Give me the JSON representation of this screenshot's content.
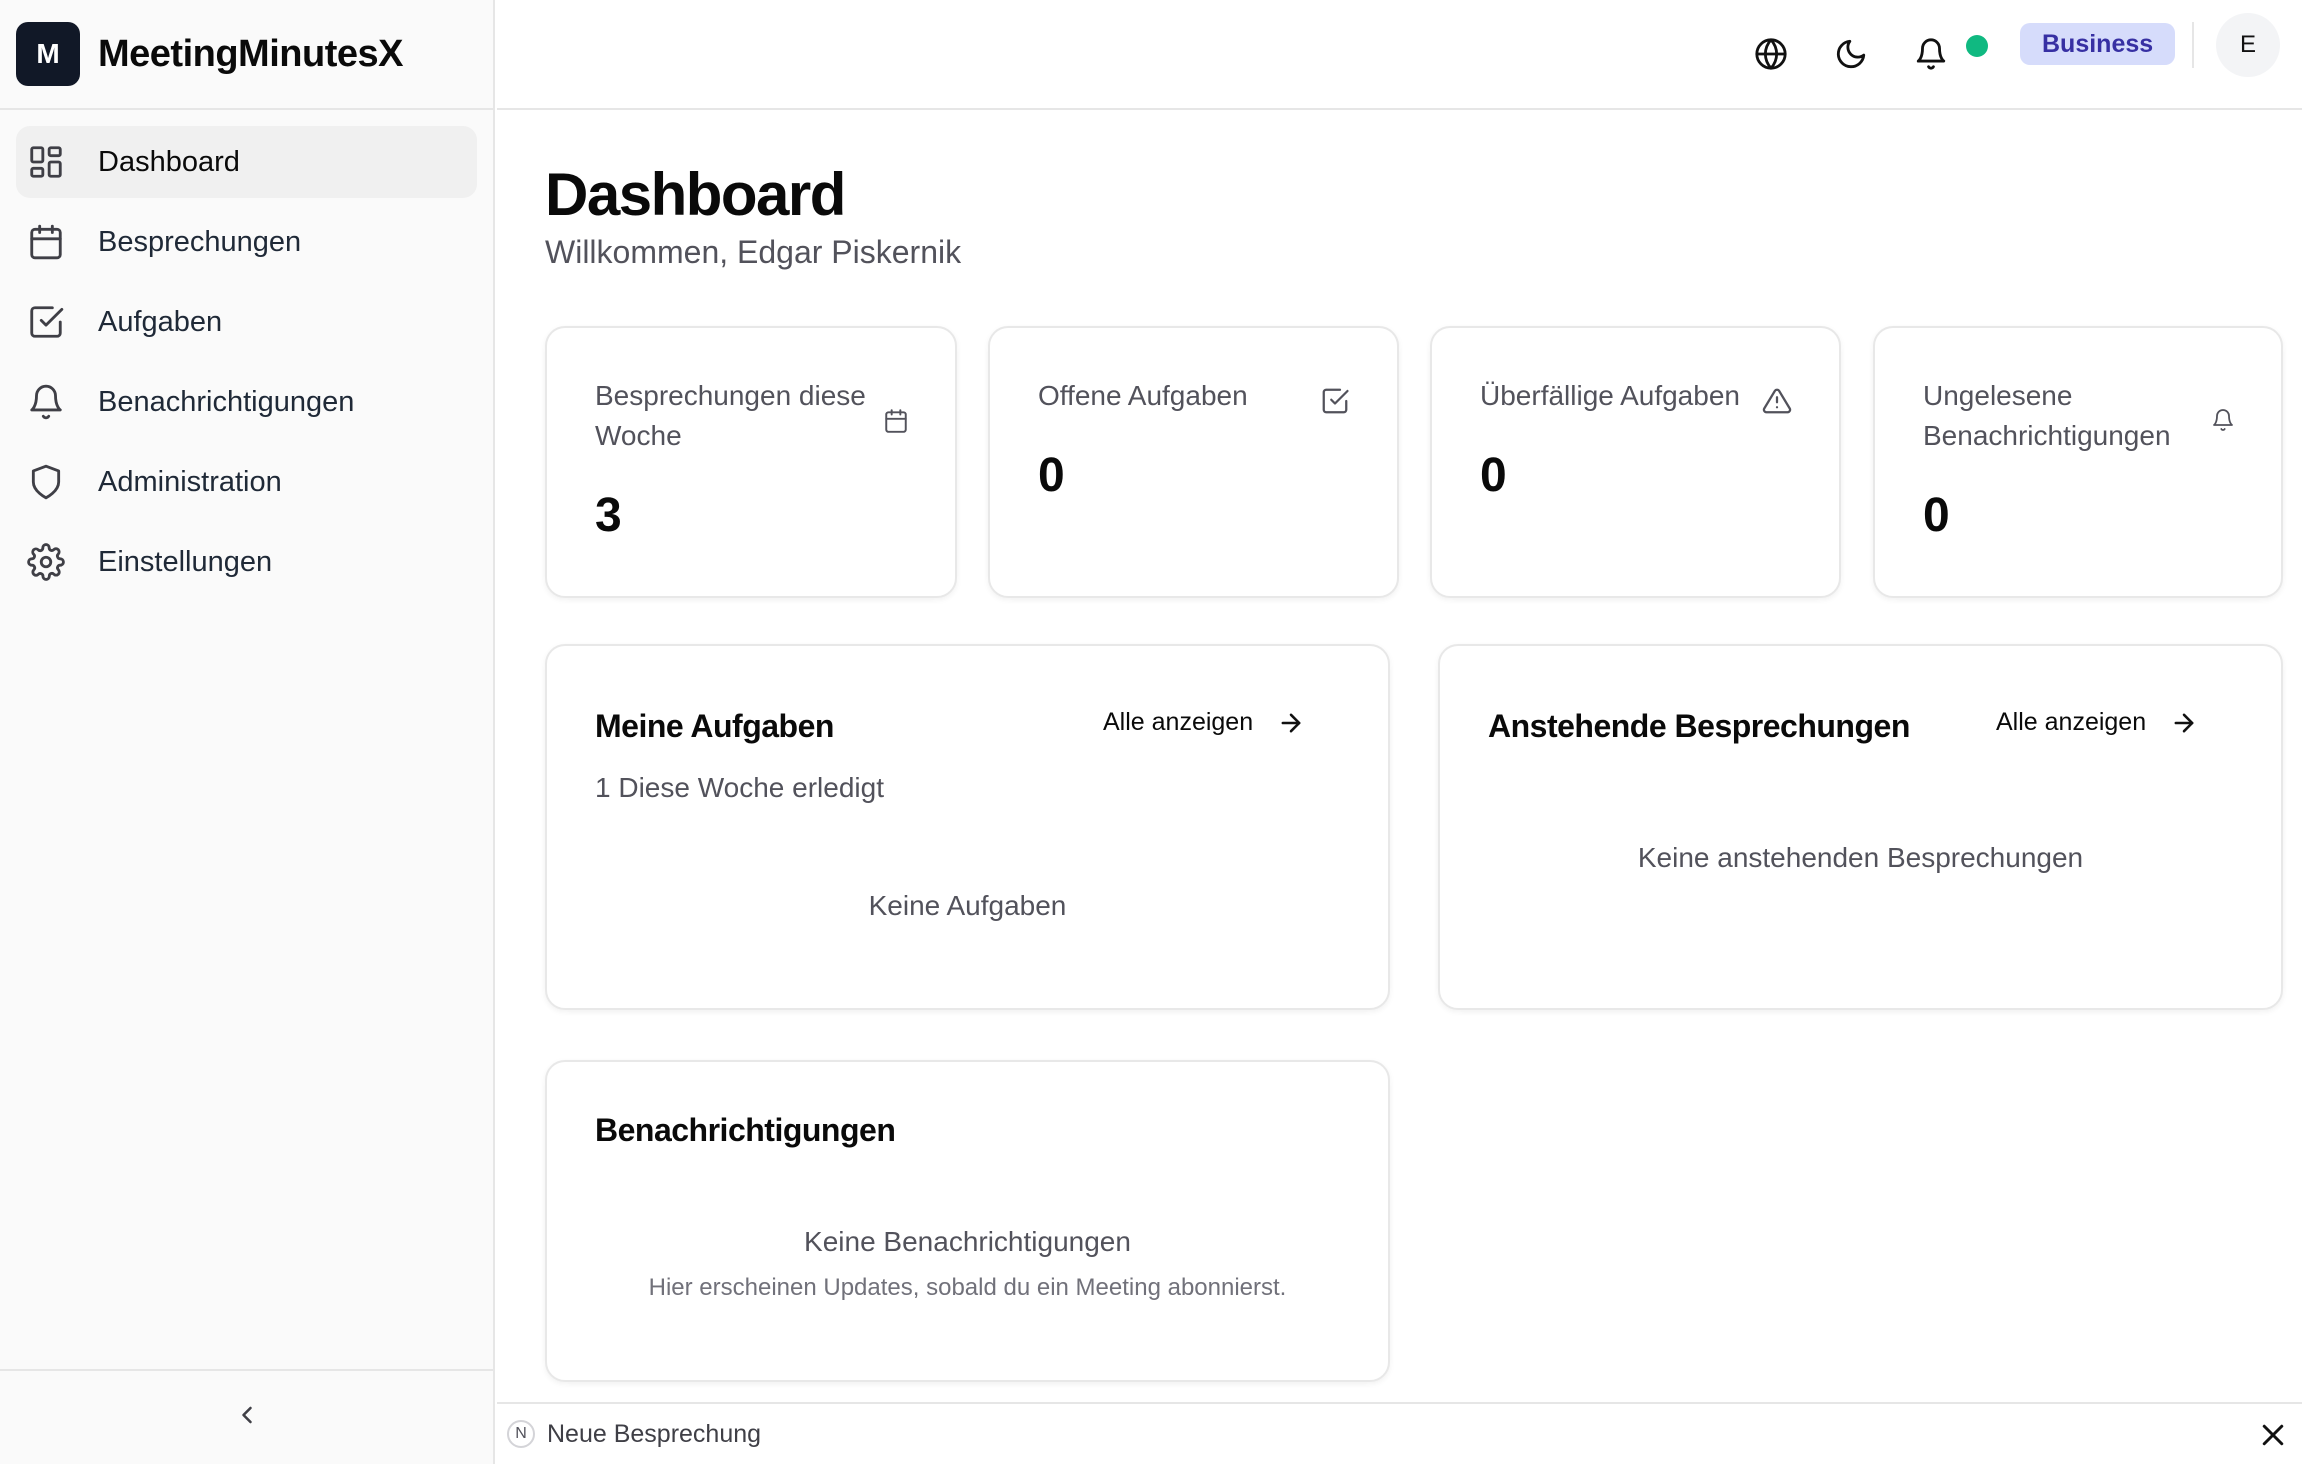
{
  "app": {
    "logo_letter": "M",
    "name": "MeetingMinutesX"
  },
  "sidebar": {
    "items": [
      {
        "label": "Dashboard",
        "icon": "layout-grid-icon",
        "active": true
      },
      {
        "label": "Besprechungen",
        "icon": "calendar-icon"
      },
      {
        "label": "Aufgaben",
        "icon": "check-square-icon"
      },
      {
        "label": "Benachrichtigungen",
        "icon": "bell-icon"
      },
      {
        "label": "Administration",
        "icon": "shield-icon"
      },
      {
        "label": "Einstellungen",
        "icon": "gear-icon"
      }
    ],
    "collapse_icon": "chevron-left-icon"
  },
  "header": {
    "icons": [
      "globe-icon",
      "moon-icon",
      "bell-icon"
    ],
    "status_color": "#10b981",
    "plan_badge": "Business",
    "avatar_initial": "E"
  },
  "page": {
    "title": "Dashboard",
    "subtitle": "Willkommen, Edgar Piskernik"
  },
  "stats": [
    {
      "label": "Besprechungen diese Woche",
      "value": "3",
      "icon": "calendar-icon"
    },
    {
      "label": "Offene Aufgaben",
      "value": "0",
      "icon": "check-square-icon"
    },
    {
      "label": "Überfällige Aufgaben",
      "value": "0",
      "icon": "alert-triangle-icon"
    },
    {
      "label": "Ungelesene Benachrichtigungen",
      "value": "0",
      "icon": "bell-icon"
    }
  ],
  "panels": {
    "tasks": {
      "title": "Meine Aufgaben",
      "link": "Alle anzeigen",
      "sub": "1 Diese Woche erledigt",
      "empty": "Keine Aufgaben"
    },
    "meetings": {
      "title": "Anstehende Besprechungen",
      "link": "Alle anzeigen",
      "empty": "Keine anstehenden Besprechungen"
    },
    "notifications": {
      "title": "Benachrichtigungen",
      "empty": "Keine Benachrichtigungen",
      "empty_sub": "Hier erscheinen Updates, sobald du ein Meeting abonnierst."
    }
  },
  "bottom_bar": {
    "shortcut_key": "N",
    "label": "Neue Besprechung"
  },
  "colors": {
    "accent_badge_bg": "#d6dcfb",
    "accent_badge_text": "#3730a3",
    "online": "#10b981"
  }
}
